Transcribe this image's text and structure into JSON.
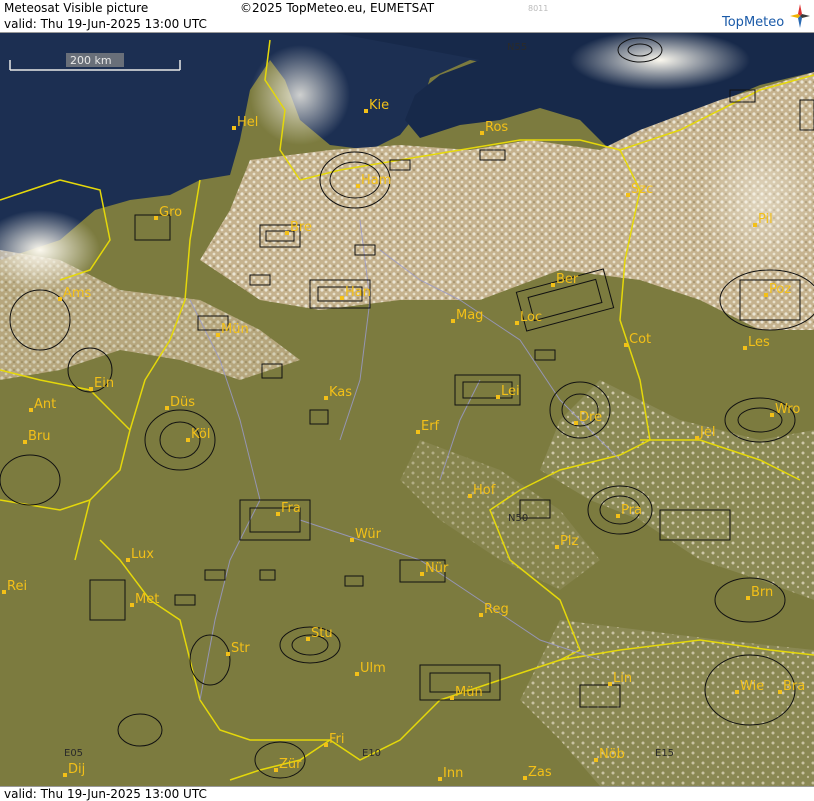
{
  "header": {
    "product": "Meteosat Visible picture",
    "copyright": "©2025 TopMeteo.eu, EUMETSAT",
    "valid": "valid:  Thu  19-Jun-2025  13:00 UTC",
    "code": "8011",
    "logo": "TopMeteo"
  },
  "footer": {
    "valid": "valid:  Thu  19-Jun-2025  13:00 UTC"
  },
  "scale": {
    "label": "200 km"
  },
  "grid_labels": {
    "n55": "N55",
    "n50": "N50",
    "e05": "E05",
    "e10": "E10",
    "e15": "E15"
  },
  "cities": [
    {
      "name": "Hel"
    },
    {
      "name": "Kie"
    },
    {
      "name": "Ros"
    },
    {
      "name": "Ham"
    },
    {
      "name": "Gro"
    },
    {
      "name": "Szc"
    },
    {
      "name": "Pil"
    },
    {
      "name": "Bre"
    },
    {
      "name": "Ams"
    },
    {
      "name": "Han"
    },
    {
      "name": "Ber"
    },
    {
      "name": "Poz"
    },
    {
      "name": "Mün"
    },
    {
      "name": "Mag"
    },
    {
      "name": "Loc"
    },
    {
      "name": "Cot"
    },
    {
      "name": "Les"
    },
    {
      "name": "Ein"
    },
    {
      "name": "Kas"
    },
    {
      "name": "Lei"
    },
    {
      "name": "Ant"
    },
    {
      "name": "Düs"
    },
    {
      "name": "Dre"
    },
    {
      "name": "Wro"
    },
    {
      "name": "Bru"
    },
    {
      "name": "Köl"
    },
    {
      "name": "Erf"
    },
    {
      "name": "Jel"
    },
    {
      "name": "Hof"
    },
    {
      "name": "Fra"
    },
    {
      "name": "Pra"
    },
    {
      "name": "Wür"
    },
    {
      "name": "Plz"
    },
    {
      "name": "Lux"
    },
    {
      "name": "Nür"
    },
    {
      "name": "Rei"
    },
    {
      "name": "Met"
    },
    {
      "name": "Reg"
    },
    {
      "name": "Brn"
    },
    {
      "name": "Stu"
    },
    {
      "name": "Str"
    },
    {
      "name": "Lin"
    },
    {
      "name": "Ulm"
    },
    {
      "name": "Mün"
    },
    {
      "name": "Wie"
    },
    {
      "name": "Bra"
    },
    {
      "name": "Fri"
    },
    {
      "name": "Zür"
    },
    {
      "name": "Nöb"
    },
    {
      "name": "Dij"
    },
    {
      "name": "Inn"
    },
    {
      "name": "Zas"
    }
  ]
}
